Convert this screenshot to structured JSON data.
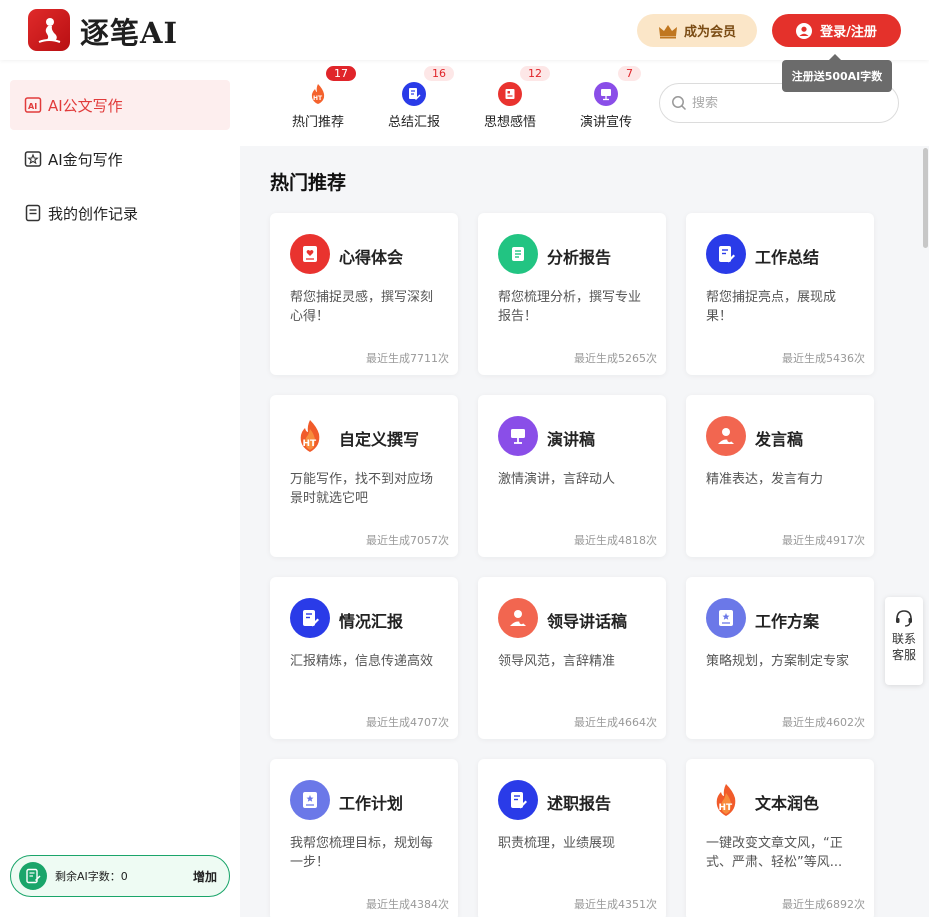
{
  "header": {
    "logo_text": "逐笔AI",
    "vip_label": "成为会员",
    "login_label": "登录/注册",
    "tooltip": "注册送500AI字数"
  },
  "sidebar": {
    "items": [
      {
        "label": "AI公文写作",
        "icon": "ai-doc-icon",
        "active": true
      },
      {
        "label": "AI金句写作",
        "icon": "ai-star-icon",
        "active": false
      },
      {
        "label": "我的创作记录",
        "icon": "record-icon",
        "active": false
      }
    ],
    "quota": {
      "label": "剩余AI字数：0",
      "add_label": "增加"
    }
  },
  "categories": {
    "items": [
      {
        "label": "热门推荐",
        "count": "17",
        "icon": "fire-icon"
      },
      {
        "label": "总结汇报",
        "count": "16",
        "icon": "summary-icon"
      },
      {
        "label": "思想感悟",
        "count": "12",
        "icon": "thought-icon"
      },
      {
        "label": "演讲宣传",
        "count": "7",
        "icon": "speech-icon"
      }
    ],
    "search_placeholder": "搜索"
  },
  "main": {
    "section_title": "热门推荐",
    "cards": [
      {
        "title": "心得体会",
        "desc": "帮您捕捉灵感，撰写深刻心得！",
        "stat": "最近生成7711次",
        "icon": "heart-doc-icon",
        "color": "#e9332f"
      },
      {
        "title": "分析报告",
        "desc": "帮您梳理分析，撰写专业报告！",
        "stat": "最近生成5265次",
        "icon": "scroll-icon",
        "color": "#22c482"
      },
      {
        "title": "工作总结",
        "desc": "帮您捕捉亮点，展现成果！",
        "stat": "最近生成5436次",
        "icon": "pen-doc-icon",
        "color": "#2a3be8"
      },
      {
        "title": "自定义撰写",
        "desc": "万能写作，找不到对应场景时就选它吧",
        "stat": "最近生成7057次",
        "icon": "fire-ht-icon",
        "color": "#f15b2a"
      },
      {
        "title": "演讲稿",
        "desc": "激情演讲，言辞动人",
        "stat": "最近生成4818次",
        "icon": "podium-icon",
        "color": "#8a4ee8"
      },
      {
        "title": "发言稿",
        "desc": "精准表达，发言有力",
        "stat": "最近生成4917次",
        "icon": "speaker-icon",
        "color": "#f26650"
      },
      {
        "title": "情况汇报",
        "desc": "汇报精炼，信息传递高效",
        "stat": "最近生成4707次",
        "icon": "pen-doc-icon",
        "color": "#2a3be8"
      },
      {
        "title": "领导讲话稿",
        "desc": "领导风范，言辞精准",
        "stat": "最近生成4664次",
        "icon": "speaker-icon",
        "color": "#f26650"
      },
      {
        "title": "工作方案",
        "desc": "策略规划，方案制定专家",
        "stat": "最近生成4602次",
        "icon": "plan-doc-icon",
        "color": "#6b78e8"
      },
      {
        "title": "工作计划",
        "desc": "我帮您梳理目标，规划每一步！",
        "stat": "最近生成4384次",
        "icon": "plan-doc-icon",
        "color": "#6b78e8"
      },
      {
        "title": "述职报告",
        "desc": "职责梳理，业绩展现",
        "stat": "最近生成4351次",
        "icon": "pen-doc-icon",
        "color": "#2a3be8"
      },
      {
        "title": "文本润色",
        "desc": "一键改变文章文风，“正式、严肃、轻松”等风...",
        "stat": "最近生成6892次",
        "icon": "fire-ht-icon",
        "color": "#f15b2a"
      }
    ]
  },
  "service": {
    "label": "联系客服"
  }
}
